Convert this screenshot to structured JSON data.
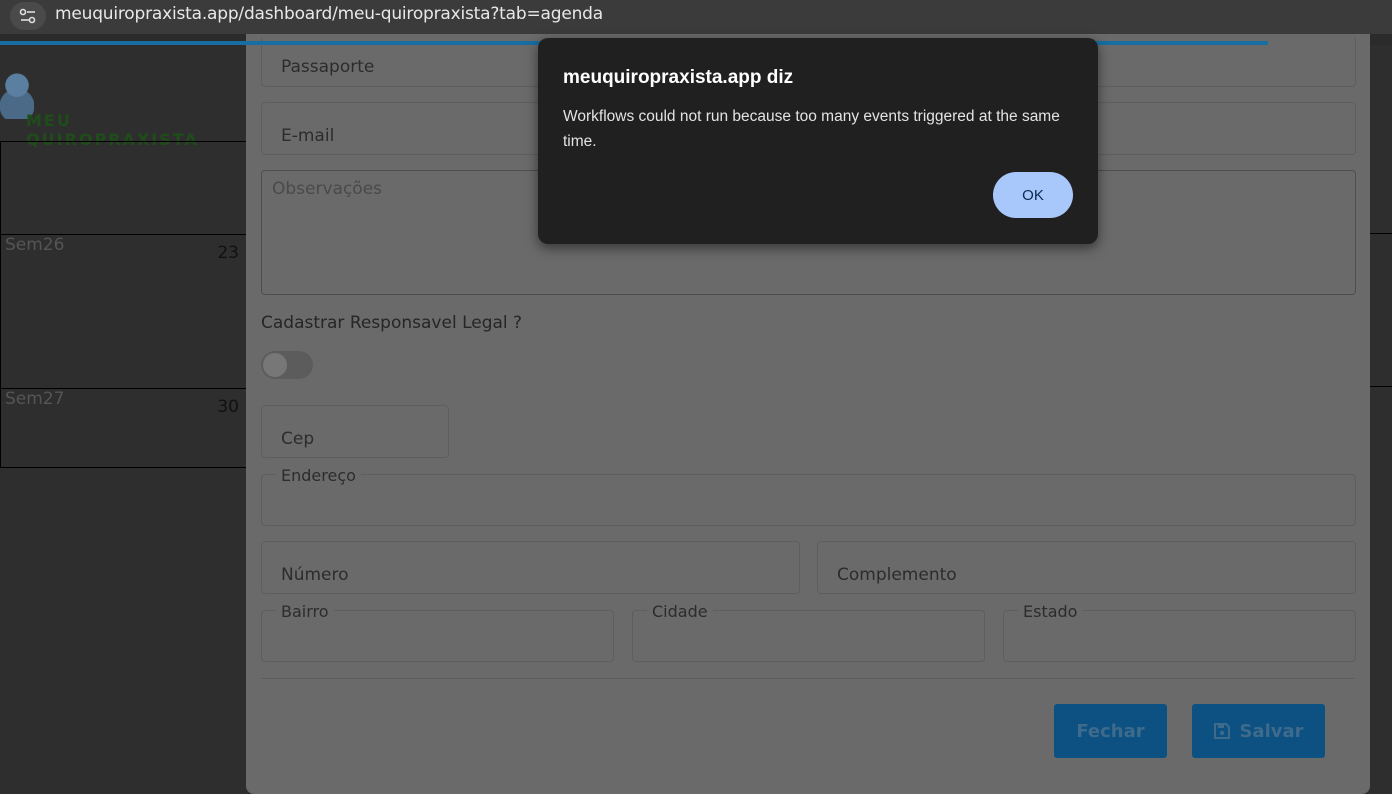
{
  "browser": {
    "url": "meuquiropraxista.app/dashboard/meu-quiropraxista?tab=agenda"
  },
  "background": {
    "logo_text": "MEU QUIROPRAXISTA",
    "calendar_rows": [
      {
        "week": "Sem26",
        "day": "23"
      },
      {
        "week": "Sem27",
        "day": "30"
      }
    ]
  },
  "form": {
    "passaporte_placeholder": "Passaporte",
    "email_placeholder": "E-mail",
    "observacoes_placeholder": "Observações",
    "responsavel_label": "Cadastrar Responsavel Legal ?",
    "responsavel_toggle_on": false,
    "cep_placeholder": "Cep",
    "endereco_label": "Endereço",
    "numero_placeholder": "Número",
    "complemento_placeholder": "Complemento",
    "bairro_label": "Bairro",
    "cidade_label": "Cidade",
    "estado_label": "Estado",
    "fechar_label": "Fechar",
    "salvar_label": "Salvar"
  },
  "alert": {
    "title": "meuquiropraxista.app diz",
    "message": "Workflows could not run because too many events triggered at the same time.",
    "ok_label": "OK"
  },
  "colors": {
    "accent": "#176ea0",
    "button": "#0d5182",
    "alert_button": "#a8c7fa",
    "alert_bg": "#202020"
  }
}
